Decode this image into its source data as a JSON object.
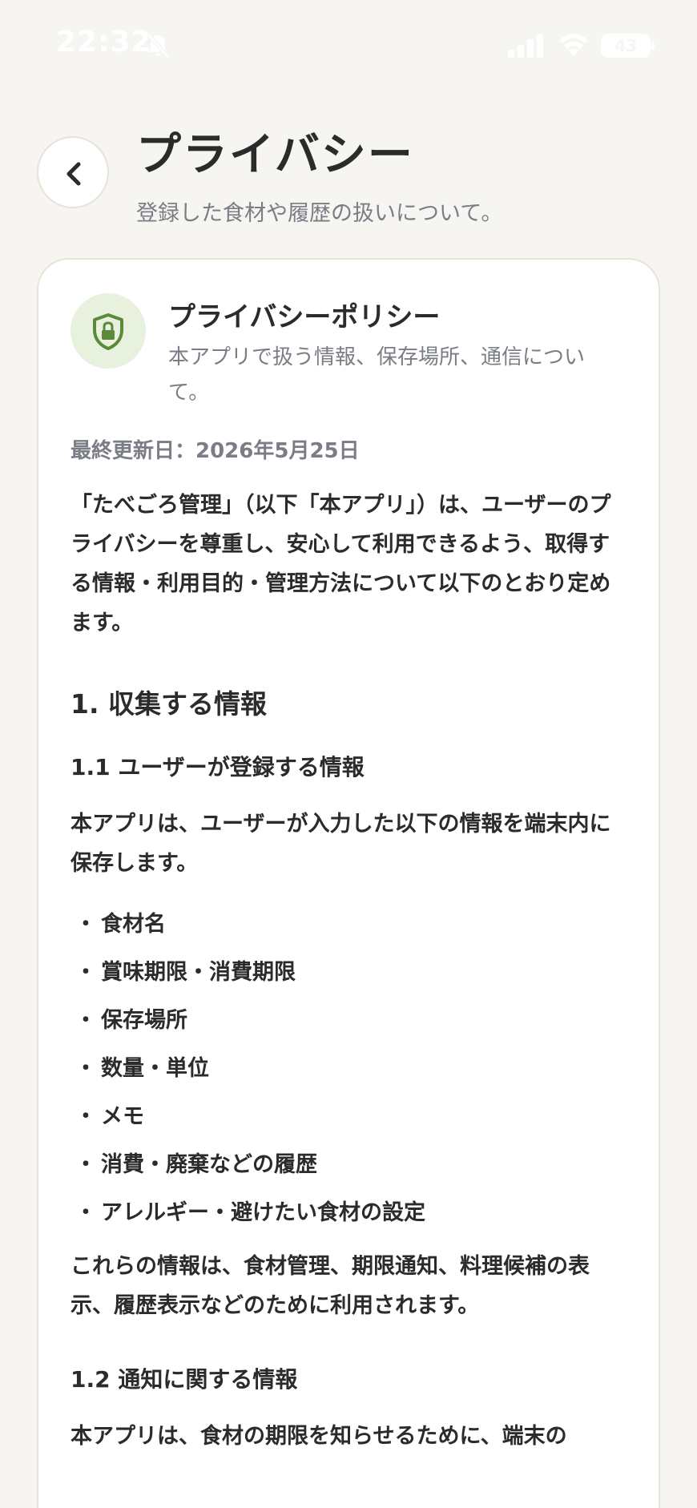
{
  "status_bar": {
    "time": "22:32",
    "battery": "43"
  },
  "header": {
    "title": "プライバシー",
    "subtitle": "登録した食材や履歴の扱いについて。"
  },
  "card": {
    "title": "プライバシーポリシー",
    "description": "本アプリで扱う情報、保存場所、通信について。",
    "updated": "最終更新日：2026年5月25日",
    "intro": "「たべごろ管理」（以下「本アプリ」）は、ユーザーのプライバシーを尊重し、安心して利用できるよう、取得する情報・利用目的・管理方法について以下のとおり定めます。",
    "section1_title": "1. 収集する情報",
    "section1_1_title": "1.1 ユーザーが登録する情報",
    "section1_1_text": "本アプリは、ユーザーが入力した以下の情報を端末内に保存します。",
    "bullet_symbol": "・",
    "items": [
      "食材名",
      "賞味期限・消費期限",
      "保存場所",
      "数量・単位",
      "メモ",
      "消費・廃棄などの履歴",
      "アレルギー・避けたい食材の設定"
    ],
    "section1_1_usage": "これらの情報は、食材管理、期限通知、料理候補の表示、履歴表示などのために利用されます。",
    "section1_2_title": "1.2 通知に関する情報",
    "section1_2_text": "本アプリは、食材の期限を知らせるために、端末の"
  },
  "colors": {
    "background": "#f6f5f1",
    "card": "#ffffff",
    "accent_green": "#5c8a3a",
    "icon_bg": "#e8f1de",
    "muted_text": "#7a7d85"
  }
}
